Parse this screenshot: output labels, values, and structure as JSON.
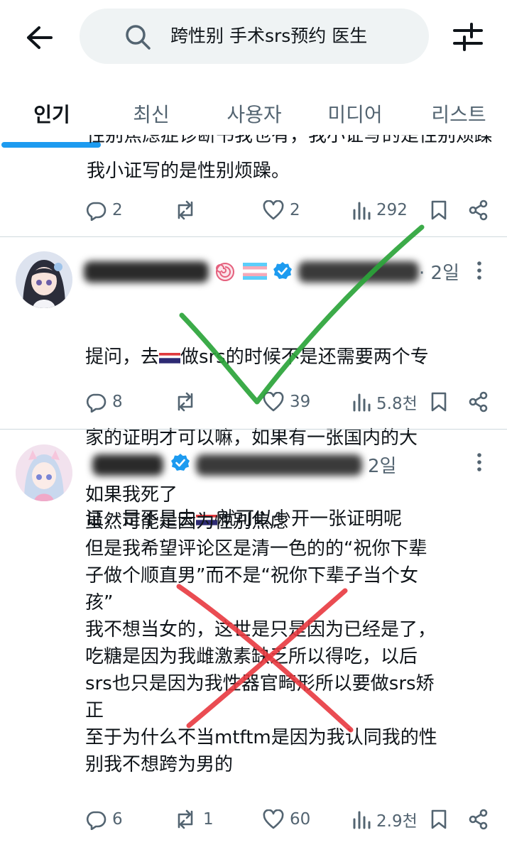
{
  "header": {
    "search_query": "跨性别 手术srs预约 医生"
  },
  "tabs": [
    {
      "label": "인기"
    },
    {
      "label": "최신"
    },
    {
      "label": "사용자"
    },
    {
      "label": "미디어"
    },
    {
      "label": "리스트"
    }
  ],
  "tweets": [
    {
      "text_partial_top": "性别焦虑症诊断书我也有，我小证写的是性别烦躁。",
      "text_visible": "我小证写的是性别烦躁。",
      "replies": "2",
      "retweets": "",
      "likes": "2",
      "views": "292"
    },
    {
      "timestamp": "· 2일",
      "text_line1_a": "提问，去",
      "text_line1_b": "做srs的时候不是还需要两个专",
      "text_line2": "家的证明才可以嘛，如果有一张国内的大",
      "text_line3_a": "证，是不是去",
      "text_line3_b": "就可以少开一张证明呢",
      "replies": "8",
      "retweets": "",
      "likes": "39",
      "views": "5.8천"
    },
    {
      "timestamp": "2일",
      "text": "如果我死了\n虽然可能是因为性别焦虑\n但是我希望评论区是清一色的的“祝你下辈\n子做个顺直男”而不是“祝你下辈子当个女\n孩”\n我不想当女的，这世是只是因为已经是了，\n吃糖是因为我雌激素缺乏所以得吃，以后\nsrs也只是因为我性器官畸形所以要做srs矫\n正\n至于为什么不当mtftm是因为我认同我的性\n别我不想跨为男的",
      "replies": "6",
      "retweets": "1",
      "likes": "60",
      "views": "2.9천"
    }
  ],
  "colors": {
    "accent": "#1d9bf0",
    "check_mark": "#2ba43a",
    "cross_mark": "#e8393f",
    "secondary_text": "#536471",
    "thai_red": "#e03a3e",
    "thai_blue": "#2d2a73"
  },
  "icons": [
    "back-arrow-icon",
    "search-icon",
    "filter-sliders-icon",
    "reply-icon",
    "retweet-icon",
    "like-icon",
    "views-icon",
    "bookmark-icon",
    "share-icon",
    "verified-icon",
    "more-icon",
    "thailand-flag-icon",
    "transgender-flag-icon",
    "lollipop-icon",
    "check-mark-icon",
    "cross-mark-icon"
  ]
}
